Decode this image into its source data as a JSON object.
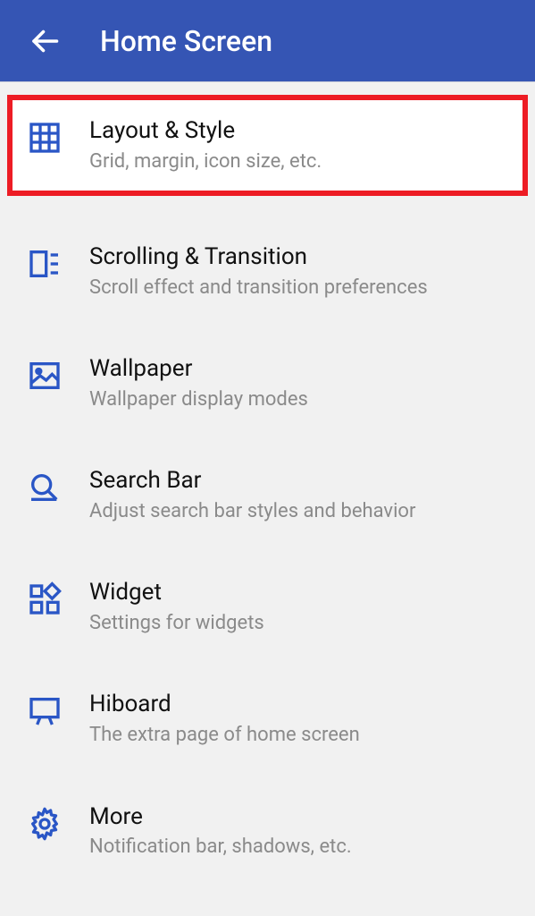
{
  "app_bar": {
    "title": "Home Screen"
  },
  "items": [
    {
      "id": "layout-style",
      "title": "Layout & Style",
      "subtitle": "Grid, margin, icon size, etc."
    },
    {
      "id": "scrolling",
      "title": "Scrolling & Transition",
      "subtitle": "Scroll effect and transition preferences"
    },
    {
      "id": "wallpaper",
      "title": "Wallpaper",
      "subtitle": "Wallpaper display modes"
    },
    {
      "id": "search-bar",
      "title": "Search Bar",
      "subtitle": "Adjust search bar styles and behavior"
    },
    {
      "id": "widget",
      "title": "Widget",
      "subtitle": "Settings for widgets"
    },
    {
      "id": "hiboard",
      "title": "Hiboard",
      "subtitle": "The extra page of home screen"
    },
    {
      "id": "more",
      "title": "More",
      "subtitle": "Notification bar, shadows, etc."
    }
  ]
}
